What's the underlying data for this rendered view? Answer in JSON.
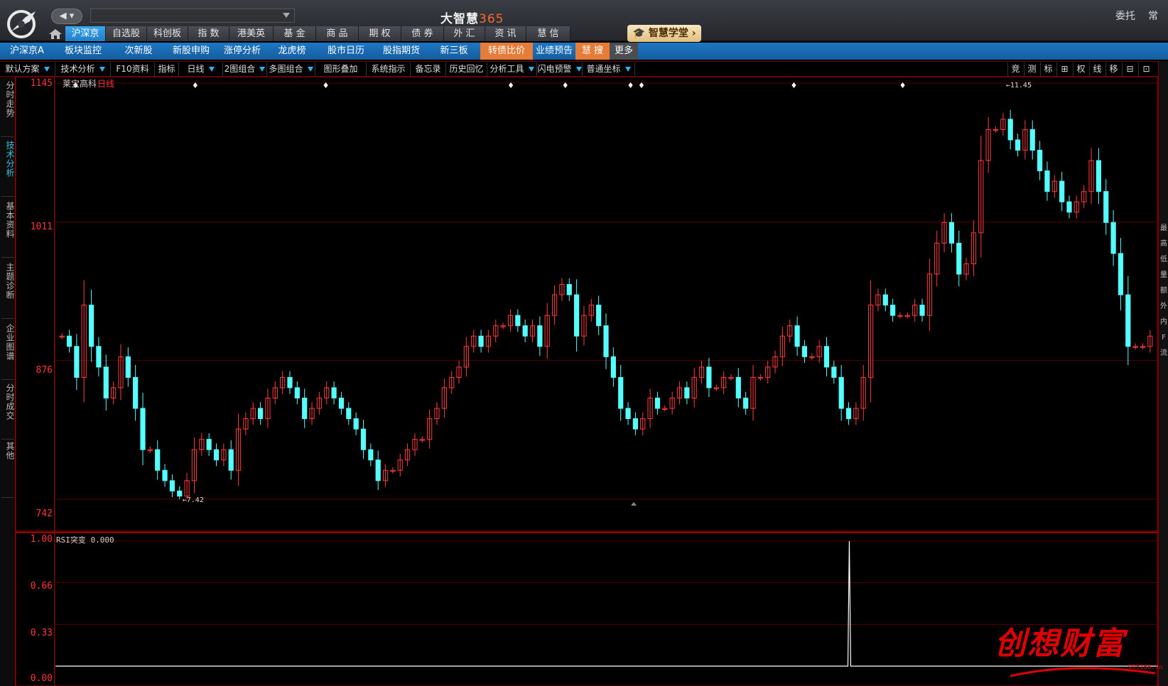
{
  "app": {
    "title_prefix": "大智慧",
    "title_suffix": "365",
    "top_right": [
      "委托",
      "常"
    ]
  },
  "menu1": [
    {
      "label": "沪深京",
      "active": true
    },
    {
      "label": "自选股"
    },
    {
      "label": "科创板"
    },
    {
      "label": "指  数"
    },
    {
      "label": "港美英"
    },
    {
      "label": "基  金"
    },
    {
      "label": "商  品"
    },
    {
      "label": "期  权"
    },
    {
      "label": "债  券"
    },
    {
      "label": "外  汇"
    },
    {
      "label": "资  讯"
    },
    {
      "label": "慧  信"
    }
  ],
  "academy_label": "智慧学堂",
  "menu2": [
    "沪深京A",
    "板块监控",
    "次新股",
    "新股申购",
    "涨停分析",
    "龙虎榜",
    "股市日历",
    "股指期货",
    "新三板",
    "转债比价",
    "业绩预告",
    "慧  搜",
    "更多"
  ],
  "toolbar": [
    "默认方案",
    "技术分析",
    "F10资料",
    "指标",
    "日线",
    "2图组合",
    "多图组合",
    "图形叠加",
    "系统指示",
    "备忘录",
    "历史回忆",
    "分析工具",
    "闪电预警",
    "普通坐标"
  ],
  "toolbar_right": [
    "竞",
    "测",
    "标",
    "⊞",
    "权",
    "线",
    "移",
    "⊟",
    "⊡"
  ],
  "left_tabs": [
    "分时走势",
    "技术分析",
    "基本资料",
    "主题诊断",
    "企业图谱",
    "分时成交",
    "其他"
  ],
  "right_strip": [
    "最",
    "高",
    "低",
    "量",
    "额",
    "外",
    "内",
    "F",
    "流"
  ],
  "chart_header": {
    "stock_name": "莱宝高科",
    "period": "日线"
  },
  "indicator_header": "RSI突变 0.000",
  "watermark": {
    "text": "创想财富",
    "url": "995168.cn"
  },
  "colors": {
    "up": "#ff3c3c",
    "down": "#54ffff",
    "axis": "#b30000",
    "bg": "#000000",
    "menu_active": "#1e7ec9",
    "menu2": "#1a6db6",
    "highlight": "#e57c39"
  },
  "chart_data": [
    {
      "type": "candlestick",
      "title": "莱宝高科 日线",
      "y_ticks": [
        "1145",
        "1011",
        "876",
        "742"
      ],
      "ylim": [
        7.42,
        11.45
      ],
      "annotations": [
        {
          "label": "11.45",
          "type": "high"
        },
        {
          "label": "7.42",
          "type": "low"
        }
      ],
      "series": [
        {
          "values": [
            9.0,
            8.9,
            8.6,
            9.3,
            8.9,
            8.7,
            8.4,
            8.5,
            8.8,
            8.6,
            8.3,
            7.9,
            7.9,
            7.7,
            7.6,
            7.5,
            7.45,
            7.6,
            7.9,
            8.0,
            7.9,
            7.8,
            7.9,
            7.7,
            8.1,
            8.2,
            8.3,
            8.2,
            8.4,
            8.5,
            8.6,
            8.5,
            8.4,
            8.2,
            8.3,
            8.4,
            8.5,
            8.4,
            8.3,
            8.2,
            8.1,
            7.9,
            7.8,
            7.6,
            7.7,
            7.7,
            7.8,
            7.9,
            8.0,
            8.0,
            8.2,
            8.3,
            8.5,
            8.6,
            8.7,
            8.9,
            9.0,
            8.9,
            9.0,
            9.1,
            9.1,
            9.2,
            9.1,
            9.0,
            9.1,
            8.9,
            9.2,
            9.4,
            9.5,
            9.4,
            9.0,
            9.2,
            9.3,
            9.1,
            8.8,
            8.6,
            8.3,
            8.2,
            8.1,
            8.2,
            8.4,
            8.3,
            8.3,
            8.4,
            8.5,
            8.4,
            8.6,
            8.7,
            8.5,
            8.5,
            8.6,
            8.6,
            8.4,
            8.3,
            8.6,
            8.6,
            8.7,
            8.8,
            9.0,
            9.1,
            8.9,
            8.8,
            8.8,
            8.9,
            8.7,
            8.6,
            8.3,
            8.2,
            8.3,
            8.6,
            9.3,
            9.4,
            9.3,
            9.2,
            9.2,
            9.2,
            9.3,
            9.2,
            9.6,
            9.9,
            10.1,
            9.9,
            9.6,
            9.7,
            10.0,
            10.7,
            11.0,
            11.0,
            11.1,
            10.9,
            10.8,
            11.0,
            10.8,
            10.6,
            10.4,
            10.5,
            10.3,
            10.2,
            10.3,
            10.4,
            10.7,
            10.4,
            10.1,
            9.8,
            9.4,
            8.9,
            8.9,
            8.9,
            9.0
          ]
        }
      ]
    },
    {
      "type": "line",
      "title": "RSI突变",
      "y_ticks": [
        "1.00",
        "0.66",
        "0.33",
        "0.00"
      ],
      "ylim": [
        0,
        1
      ],
      "series": [
        {
          "name": "RSI突变",
          "spike_at": 0.72,
          "values": [
            0,
            1,
            0
          ]
        }
      ]
    }
  ]
}
